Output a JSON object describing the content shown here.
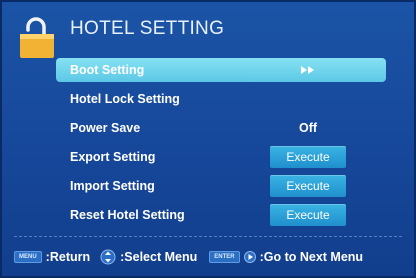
{
  "header": {
    "title": "HOTEL SETTING",
    "icon": "padlock-icon"
  },
  "menu": {
    "items": [
      {
        "label": "Boot Setting",
        "value": "",
        "selected": true,
        "arrow": "▶▶"
      },
      {
        "label": "Hotel Lock Setting",
        "value": "",
        "selected": false
      },
      {
        "label": "Power Save",
        "value": "Off",
        "selected": false
      },
      {
        "label": "Export Setting",
        "button": "Execute",
        "selected": false
      },
      {
        "label": "Import Setting",
        "button": "Execute",
        "selected": false
      },
      {
        "label": "Reset Hotel Setting",
        "button": "Execute",
        "selected": false
      }
    ]
  },
  "footer": {
    "return_key": "MENU",
    "return_label": ":Return",
    "select_label": ":Select Menu",
    "enter_key": "ENTER",
    "next_label": ":Go to Next Menu"
  },
  "colors": {
    "background": "#16479a",
    "highlight": "#6fd4ec",
    "button": "#2a9fd8",
    "text": "#ffffff"
  }
}
